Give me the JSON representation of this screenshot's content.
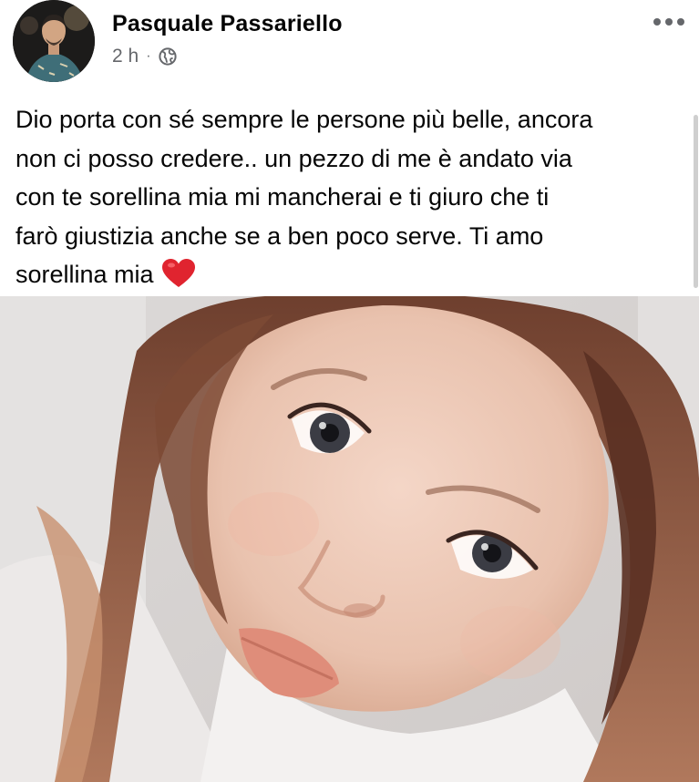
{
  "post": {
    "author": {
      "name": "Pasquale Passariello"
    },
    "timestamp": "2 h",
    "separator": "·",
    "privacy_icon": "globe-icon",
    "more_icon": "more-options-icon",
    "text": "Dio porta con sé sempre le persone più belle, ancora\nnon ci posso credere.. un pezzo di me è andato via\ncon te sorellina mia mi mancherai e ti giuro che ti\nfarò giustizia anche se a ben poco serve. Ti amo\nsorellina mia",
    "emoji": "red-heart-icon",
    "photo": "selfie-photo"
  },
  "colors": {
    "text": "#050505",
    "meta": "#65676b",
    "heart": "#e0242f",
    "background": "#ffffff"
  }
}
